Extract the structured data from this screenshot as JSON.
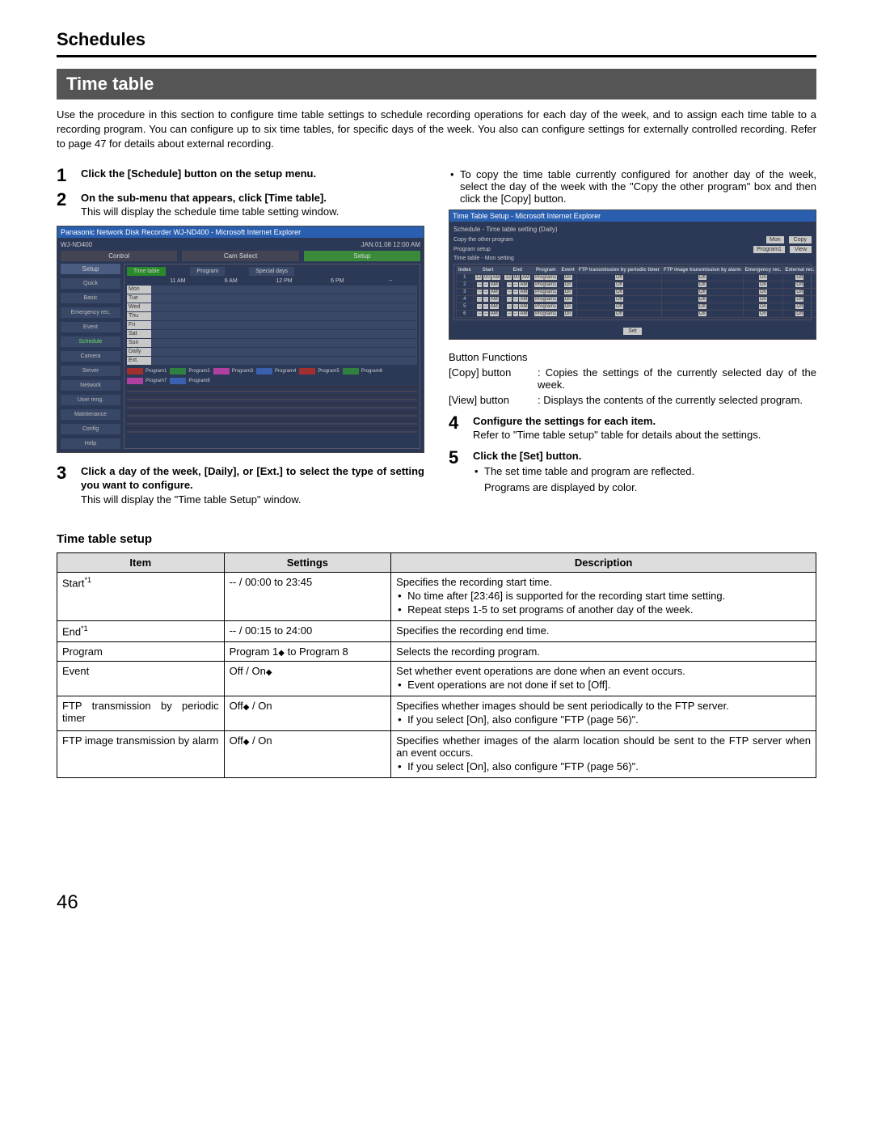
{
  "header": {
    "title": "Schedules"
  },
  "band": {
    "title": "Time table"
  },
  "intro": "Use the procedure in this section to configure time table settings to schedule recording operations for each day of the week, and to assign each time table to a recording program. You can configure up to six time tables, for specific days of the week. You also can configure settings for externally controlled recording. Refer to page 47 for details about external recording.",
  "steps_left": {
    "s1": {
      "num": "1",
      "bold": "Click the [Schedule] button on the setup menu."
    },
    "s2": {
      "num": "2",
      "bold": "On the sub-menu that appears, click [Time table].",
      "text": "This will display the schedule time table setting window."
    },
    "s3": {
      "num": "3",
      "bold": "Click a day of the week, [Daily], or [Ext.] to select the type of setting you want to configure.",
      "text": "This will display the \"Time table Setup\" window."
    }
  },
  "steps_right": {
    "pre_bullet": "To copy the time table currently configured for another day of the week, select the day of the week with the \"Copy the other program\" box and then click the [Copy] button.",
    "btn_funcs_title": "Button Functions",
    "bf1_label": "[Copy] button",
    "bf1_desc": ": Copies the settings of the currently selected day of the week.",
    "bf2_label": "[View] button",
    "bf2_desc": ": Displays the contents of the currently selected program.",
    "s4": {
      "num": "4",
      "bold": "Configure the settings for each item.",
      "text": "Refer to \"Time table setup\" table for details about the settings."
    },
    "s5": {
      "num": "5",
      "bold": "Click the [Set] button.",
      "b1": "The set time table and program are reflected.",
      "b2": "Programs are displayed by color."
    }
  },
  "screenshot1": {
    "titlebar": "Panasonic Network Disk Recorder WJ-ND400 - Microsoft Internet Explorer",
    "model": "WJ-ND400",
    "datetime": "JAN.01.08  12:00  AM",
    "tabs": [
      "Control",
      "Cam Select",
      "Setup"
    ],
    "subtabs": [
      "Time table",
      "Program",
      "Special days"
    ],
    "sidebar_head": "Setup",
    "sidebar": [
      "Quick",
      "Basic",
      "Emergency rec.",
      "Event",
      "Schedule",
      "Camera",
      "Server",
      "Network",
      "User mng.",
      "Maintenance",
      "Config",
      "Help"
    ],
    "cols": [
      "11 AM",
      "6 AM",
      "12 PM",
      "6 PM",
      "--"
    ],
    "days": [
      "Mon",
      "Tue",
      "Wed",
      "Thu",
      "Fri",
      "Sat",
      "Sun",
      "Daily",
      "Ext."
    ],
    "legend": [
      {
        "label": "Program1",
        "color": "#a03030"
      },
      {
        "label": "Program2",
        "color": "#30803f"
      },
      {
        "label": "Program3",
        "color": "#b040a0"
      },
      {
        "label": "Program4",
        "color": "#3a60b0"
      },
      {
        "label": "Program5",
        "color": "#a03030"
      },
      {
        "label": "Program6",
        "color": "#30803f"
      },
      {
        "label": "Program7",
        "color": "#b040a0"
      },
      {
        "label": "Program8",
        "color": "#3a60b0"
      }
    ]
  },
  "screenshot2": {
    "titlebar": "Time Table Setup - Microsoft Internet Explorer",
    "heading": "Schedule - Time table setting (Daily)",
    "row1_label": "Copy the other program",
    "row1_sel": "Mon",
    "row1_btn": "Copy",
    "row2_label": "Program setup",
    "row2_sel": "Program1",
    "row2_btn": "View",
    "row3_label": "Time table - Mon setting",
    "th": [
      "Index",
      "Start",
      "End",
      "Program",
      "Event",
      "FTP transmission by periodic timer",
      "FTP image transmission by alarm",
      "Emergency rec.",
      "External rec."
    ],
    "rows": [
      {
        "idx": "1",
        "start_h": "12",
        "start_m": "00",
        "start_ap": "AM",
        "end_h": "12",
        "end_m": "00",
        "end_ap": "AM",
        "program": "Program1",
        "event": "On",
        "ftp1": "Off",
        "ftp2": "Off",
        "er": "On",
        "xr": "Off"
      },
      {
        "idx": "2",
        "start_h": "--",
        "start_m": "--",
        "start_ap": "AM",
        "end_h": "--",
        "end_m": "--",
        "end_ap": "AM",
        "program": "Program1",
        "event": "On",
        "ftp1": "Off",
        "ftp2": "Off",
        "er": "On",
        "xr": "Off"
      },
      {
        "idx": "3",
        "start_h": "--",
        "start_m": "--",
        "start_ap": "AM",
        "end_h": "--",
        "end_m": "--",
        "end_ap": "AM",
        "program": "Program1",
        "event": "On",
        "ftp1": "Off",
        "ftp2": "Off",
        "er": "On",
        "xr": "Off"
      },
      {
        "idx": "4",
        "start_h": "--",
        "start_m": "--",
        "start_ap": "AM",
        "end_h": "--",
        "end_m": "--",
        "end_ap": "AM",
        "program": "Program1",
        "event": "On",
        "ftp1": "Off",
        "ftp2": "Off",
        "er": "On",
        "xr": "Off"
      },
      {
        "idx": "5",
        "start_h": "--",
        "start_m": "--",
        "start_ap": "AM",
        "end_h": "--",
        "end_m": "--",
        "end_ap": "AM",
        "program": "Program1",
        "event": "On",
        "ftp1": "Off",
        "ftp2": "Off",
        "er": "On",
        "xr": "Off"
      },
      {
        "idx": "6",
        "start_h": "--",
        "start_m": "--",
        "start_ap": "AM",
        "end_h": "--",
        "end_m": "--",
        "end_ap": "AM",
        "program": "Program1",
        "event": "On",
        "ftp1": "Off",
        "ftp2": "Off",
        "er": "On",
        "xr": "Off"
      }
    ],
    "set_btn": "Set"
  },
  "table": {
    "title": "Time table setup",
    "th_item": "Item",
    "th_settings": "Settings",
    "th_desc": "Description",
    "rows": [
      {
        "item_html": "Start",
        "sup": "*1",
        "settings": "-- / 00:00 to 23:45",
        "desc": "Specifies the recording start time.",
        "bullets": [
          "No time after [23:46] is supported for the recording start time setting.",
          "Repeat steps 1-5 to set programs of another day of the week."
        ]
      },
      {
        "item_html": "End",
        "sup": "*1",
        "settings": "-- / 00:15 to 24:00",
        "desc": "Specifies the recording end time."
      },
      {
        "item_html": "Program",
        "settings_pre": "Program 1",
        "settings_diamond": true,
        "settings_post": " to Program 8",
        "desc": "Selects the recording program."
      },
      {
        "item_html": "Event",
        "settings_pre": "Off / On",
        "settings_diamond": true,
        "desc": "Set whether event operations are done when an event occurs.",
        "bullets": [
          "Event operations are not done if set to [Off]."
        ]
      },
      {
        "item_html": "FTP transmission by periodic timer",
        "settings_pre": "Off",
        "settings_diamond": true,
        "settings_post": " / On",
        "desc": "Specifies whether images should be sent periodically to the FTP server.",
        "bullets": [
          "If you select [On], also configure \"FTP (page 56)\"."
        ]
      },
      {
        "item_html": "FTP image transmission by alarm",
        "settings_pre": "Off",
        "settings_diamond": true,
        "settings_post": " / On",
        "desc": "Specifies whether images of the alarm location should be sent to the FTP server when an event occurs.",
        "bullets": [
          "If you select [On], also configure \"FTP (page 56)\"."
        ]
      }
    ]
  },
  "page_number": "46"
}
